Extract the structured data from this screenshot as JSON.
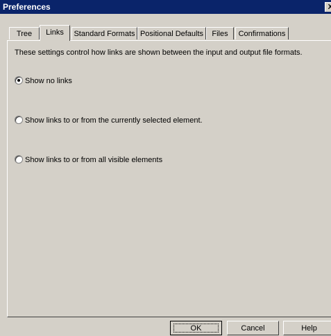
{
  "window": {
    "title": "Preferences",
    "close_glyph": "X"
  },
  "tabs": [
    {
      "label": "Tree",
      "active": false
    },
    {
      "label": "Links",
      "active": true
    },
    {
      "label": "Standard Formats",
      "active": false
    },
    {
      "label": "Positional Defaults",
      "active": false
    },
    {
      "label": "Files",
      "active": false
    },
    {
      "label": "Confirmations",
      "active": false
    }
  ],
  "links_tab": {
    "description": "These settings control how links are shown between the input and output file formats.",
    "options": [
      {
        "label": "Show no links",
        "selected": true
      },
      {
        "label": "Show links to or from the currently selected element.",
        "selected": false
      },
      {
        "label": "Show links to or from all visible elements",
        "selected": false
      }
    ]
  },
  "buttons": {
    "ok": "OK",
    "cancel": "Cancel",
    "help": "Help"
  }
}
